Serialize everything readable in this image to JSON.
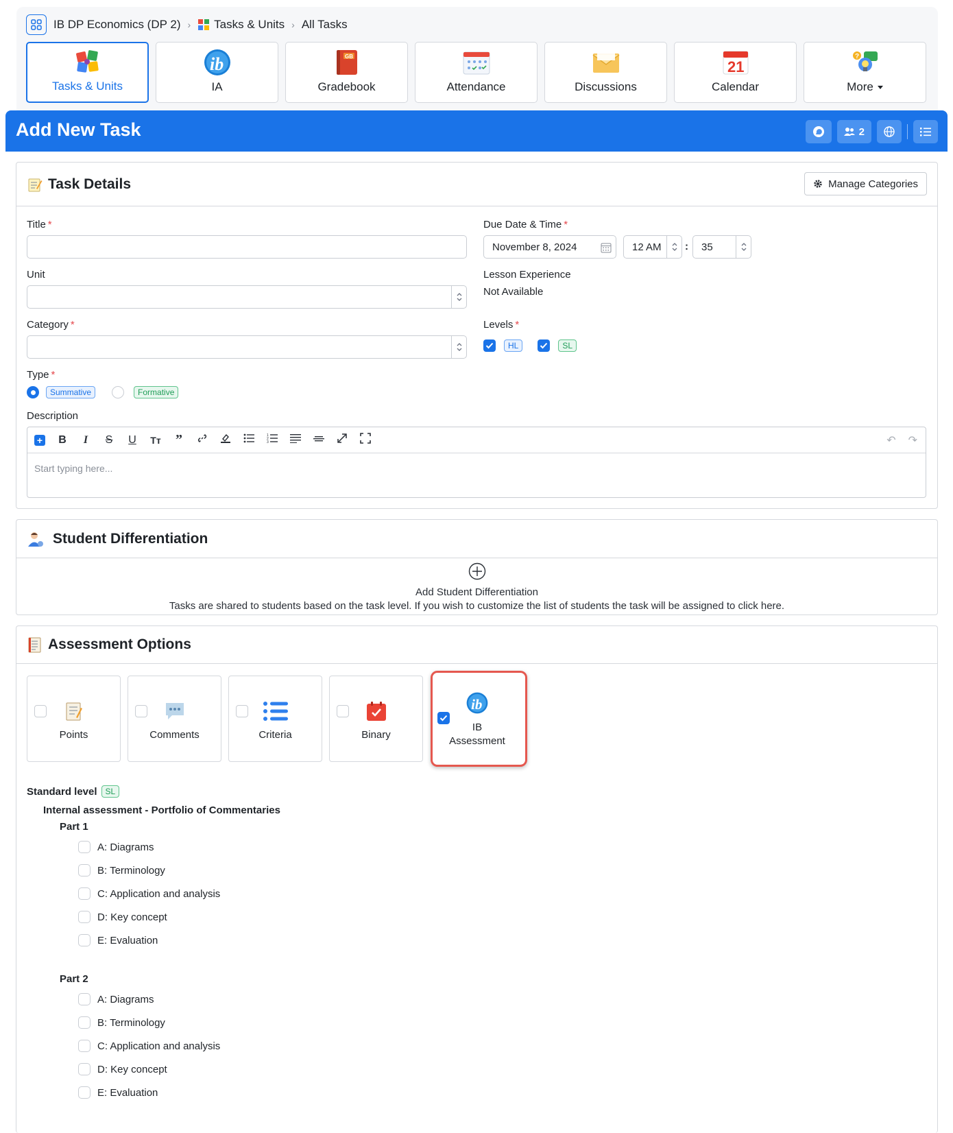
{
  "breadcrumb": {
    "course": "IB DP Economics (DP 2)",
    "section": "Tasks & Units",
    "page": "All Tasks"
  },
  "nav_tabs": [
    {
      "label": "Tasks & Units",
      "icon": "puzzle-icon"
    },
    {
      "label": "IA",
      "icon": "ib-logo-icon"
    },
    {
      "label": "Gradebook",
      "icon": "gradebook-icon"
    },
    {
      "label": "Attendance",
      "icon": "attendance-icon"
    },
    {
      "label": "Discussions",
      "icon": "envelope-icon"
    },
    {
      "label": "Calendar",
      "icon": "calendar-icon"
    },
    {
      "label": "More",
      "icon": "more-icon"
    }
  ],
  "calendar_day": "21",
  "gradebook_badge": "GB",
  "header": {
    "title": "Add New Task",
    "users_count": "2"
  },
  "task_details": {
    "heading": "Task Details",
    "manage_categories": "Manage Categories",
    "title_label": "Title",
    "unit_label": "Unit",
    "category_label": "Category",
    "type_label": "Type",
    "type_options": [
      "Summative",
      "Formative"
    ],
    "description_label": "Description",
    "description_placeholder": "Start typing here...",
    "due_label": "Due Date & Time",
    "due_date": "November 8, 2024",
    "due_hour": "12 AM",
    "due_minute": "35",
    "time_sep": ":",
    "lesson_label": "Lesson Experience",
    "lesson_value": "Not Available",
    "levels_label": "Levels",
    "levels": [
      "HL",
      "SL"
    ]
  },
  "differentiation": {
    "heading": "Student Differentiation",
    "add_label": "Add Student Differentiation",
    "note": "Tasks are shared to students based on the task level. If you wish to customize the list of students the task will be assigned to click here."
  },
  "assessment": {
    "heading": "Assessment Options",
    "options": [
      {
        "label": "Points",
        "checked": false
      },
      {
        "label": "Comments",
        "checked": false
      },
      {
        "label": "Criteria",
        "checked": false
      },
      {
        "label": "Binary",
        "checked": false
      },
      {
        "label": "IB Assessment",
        "checked": true
      }
    ],
    "level_label": "Standard level",
    "level_tag": "SL",
    "ia_title": "Internal assessment - Portfolio of Commentaries",
    "parts": [
      {
        "name": "Part 1",
        "criteria": [
          "A: Diagrams",
          "B: Terminology",
          "C: Application and analysis",
          "D: Key concept",
          "E: Evaluation"
        ]
      },
      {
        "name": "Part 2",
        "criteria": [
          "A: Diagrams",
          "B: Terminology",
          "C: Application and analysis",
          "D: Key concept",
          "E: Evaluation"
        ]
      }
    ]
  },
  "colors": {
    "primary": "#1a73e8",
    "required": "#e5484d",
    "highlight": "#e5584f",
    "sl_green": "#1f9d57"
  }
}
